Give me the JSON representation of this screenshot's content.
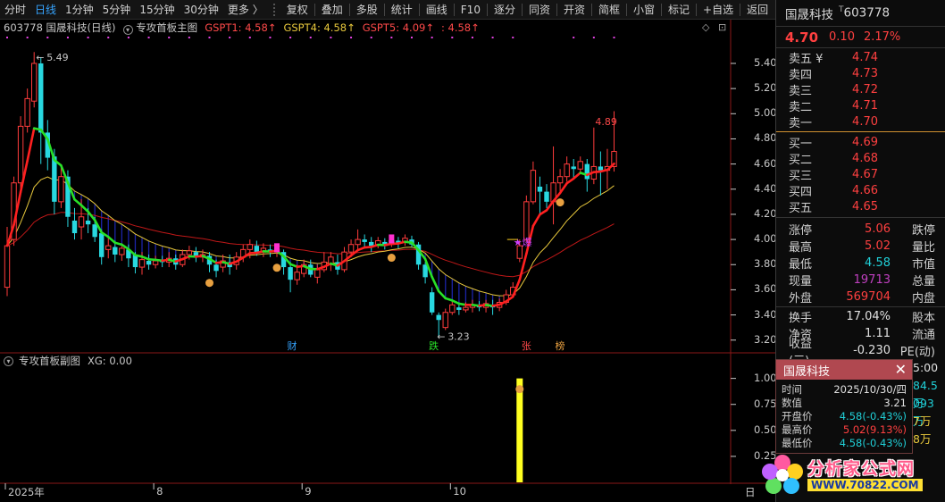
{
  "toolbar": {
    "left_items": [
      {
        "label": "分时",
        "active": false
      },
      {
        "label": "日线",
        "active": true
      },
      {
        "label": "1分钟",
        "active": false
      },
      {
        "label": "5分钟",
        "active": false
      },
      {
        "label": "15分钟",
        "active": false
      },
      {
        "label": "30分钟",
        "active": false
      },
      {
        "label": "更多 〉",
        "active": false
      }
    ],
    "right_items": [
      "复权",
      "叠加",
      "多股",
      "统计",
      "画线",
      "F10",
      "逐分",
      "同资",
      "开资",
      "简框",
      "小窗",
      "标记",
      "+自选",
      "返回"
    ]
  },
  "main_header": {
    "title": "603778 国晟科技(日线)",
    "indicator": "专攻首板主图",
    "gspt1": "GSPT1: 4.58↑",
    "gspt4": "GSPT4: 4.58↑",
    "gspt5": "GSPT5: 4.09↑",
    "extra": ": 4.58↑"
  },
  "sub_header": {
    "indicator": "专攻首板副图",
    "xg": "XG: 0.00"
  },
  "chart_labels": {
    "high_note": "5.49",
    "peak_note": "4.89",
    "low_note": "3.23",
    "signal_star": "★爆",
    "tag_cai": "财",
    "tag_die": "跌",
    "tag_zhang": "张",
    "tag_bang": "榜"
  },
  "chart_data": [
    {
      "type": "candlestick",
      "name": "main",
      "y_ticks": [
        3.2,
        3.4,
        3.6,
        3.8,
        4.0,
        4.2,
        4.4,
        4.6,
        4.8,
        5.0,
        5.2,
        5.4
      ],
      "ylim": [
        3.12,
        5.62
      ],
      "x_ticks": [
        "2025年",
        "8",
        "9",
        "10"
      ],
      "candles": [
        [
          3.62,
          3.95,
          3.55,
          4.1
        ],
        [
          4.0,
          4.45,
          3.95,
          4.5
        ],
        [
          4.45,
          4.9,
          4.4,
          4.98
        ],
        [
          4.9,
          5.12,
          4.85,
          5.2
        ],
        [
          5.1,
          5.4,
          5.05,
          5.49
        ],
        [
          5.4,
          4.85,
          4.6,
          5.45
        ],
        [
          4.85,
          4.65,
          4.55,
          4.95
        ],
        [
          4.66,
          4.3,
          4.2,
          4.72
        ],
        [
          4.3,
          4.5,
          4.25,
          4.6
        ],
        [
          4.5,
          4.18,
          4.1,
          4.55
        ],
        [
          4.15,
          4.05,
          4.0,
          4.25
        ],
        [
          4.1,
          4.18,
          4.0,
          4.32
        ],
        [
          4.15,
          4.12,
          4.05,
          4.25
        ],
        [
          4.12,
          4.02,
          3.98,
          4.18
        ],
        [
          4.05,
          3.86,
          3.8,
          4.08
        ],
        [
          3.92,
          3.95,
          3.85,
          4.02
        ],
        [
          3.94,
          3.88,
          3.82,
          3.99
        ],
        [
          3.88,
          3.93,
          3.83,
          3.97
        ],
        [
          3.92,
          3.85,
          3.78,
          3.96
        ],
        [
          3.88,
          3.78,
          3.73,
          3.9
        ],
        [
          3.78,
          3.84,
          3.72,
          3.9
        ],
        [
          3.83,
          3.8,
          3.76,
          3.88
        ],
        [
          3.8,
          3.83,
          3.77,
          3.87
        ],
        [
          3.83,
          3.82,
          3.78,
          3.87
        ],
        [
          3.82,
          3.85,
          3.78,
          3.9
        ],
        [
          3.85,
          3.8,
          3.76,
          3.88
        ],
        [
          3.8,
          3.88,
          3.78,
          3.92
        ],
        [
          3.88,
          3.91,
          3.84,
          3.95
        ],
        [
          3.9,
          3.86,
          3.82,
          3.94
        ],
        [
          3.86,
          3.88,
          3.82,
          3.92
        ],
        [
          3.87,
          3.8,
          3.74,
          3.9
        ],
        [
          3.8,
          3.75,
          3.7,
          3.84
        ],
        [
          3.78,
          3.83,
          3.74,
          3.88
        ],
        [
          3.82,
          3.78,
          3.72,
          3.88
        ],
        [
          3.8,
          3.86,
          3.76,
          3.9
        ],
        [
          3.86,
          3.92,
          3.82,
          3.96
        ],
        [
          3.92,
          3.96,
          3.85,
          4.0
        ],
        [
          3.95,
          3.9,
          3.87,
          3.99
        ],
        [
          3.9,
          3.93,
          3.86,
          3.97
        ],
        [
          3.92,
          3.9,
          3.86,
          3.96
        ],
        [
          3.9,
          3.92,
          3.86,
          3.95
        ],
        [
          3.9,
          3.78,
          3.72,
          3.92
        ],
        [
          3.78,
          3.68,
          3.58,
          3.82
        ],
        [
          3.68,
          3.74,
          3.64,
          3.8
        ],
        [
          3.73,
          3.8,
          3.7,
          3.84
        ],
        [
          3.8,
          3.72,
          3.7,
          3.84
        ],
        [
          3.7,
          3.76,
          3.65,
          3.8
        ],
        [
          3.76,
          3.82,
          3.74,
          3.9
        ],
        [
          3.8,
          3.86,
          3.75,
          3.9
        ],
        [
          3.82,
          3.76,
          3.72,
          3.88
        ],
        [
          3.76,
          3.9,
          3.74,
          3.94
        ],
        [
          3.9,
          3.96,
          3.86,
          4.0
        ],
        [
          3.96,
          4.0,
          3.92,
          4.08
        ],
        [
          4.0,
          3.98,
          3.94,
          4.04
        ],
        [
          3.98,
          3.95,
          3.9,
          4.02
        ],
        [
          3.96,
          3.99,
          3.93,
          4.02
        ],
        [
          3.98,
          3.95,
          3.92,
          4.01
        ],
        [
          3.96,
          3.99,
          3.94,
          4.02
        ],
        [
          3.99,
          3.97,
          3.93,
          4.02
        ],
        [
          3.98,
          4.01,
          3.95,
          4.04
        ],
        [
          4.0,
          3.96,
          3.94,
          4.03
        ],
        [
          3.96,
          3.8,
          3.76,
          3.98
        ],
        [
          3.8,
          3.7,
          3.65,
          3.82
        ],
        [
          3.58,
          3.42,
          3.4,
          3.62
        ],
        [
          3.4,
          3.36,
          3.23,
          3.42
        ],
        [
          3.3,
          3.42,
          3.28,
          3.45
        ],
        [
          3.42,
          3.48,
          3.4,
          3.52
        ],
        [
          3.46,
          3.44,
          3.4,
          3.5
        ],
        [
          3.44,
          3.46,
          3.42,
          3.5
        ],
        [
          3.46,
          3.48,
          3.42,
          3.52
        ],
        [
          3.48,
          3.46,
          3.43,
          3.51
        ],
        [
          3.46,
          3.49,
          3.42,
          3.52
        ],
        [
          3.48,
          3.46,
          3.4,
          3.52
        ],
        [
          3.46,
          3.5,
          3.43,
          3.53
        ],
        [
          3.5,
          3.56,
          3.48,
          3.6
        ],
        [
          3.56,
          3.62,
          3.54,
          3.66
        ],
        [
          3.85,
          3.95,
          3.82,
          4.0
        ],
        [
          4.0,
          4.3,
          3.98,
          4.35
        ],
        [
          4.3,
          4.55,
          4.28,
          4.62
        ],
        [
          4.42,
          4.38,
          4.2,
          4.5
        ],
        [
          4.38,
          4.3,
          4.25,
          4.44
        ],
        [
          4.3,
          4.45,
          4.12,
          4.74
        ],
        [
          4.45,
          4.5,
          4.38,
          4.56
        ],
        [
          4.5,
          4.6,
          4.46,
          4.66
        ],
        [
          4.58,
          4.56,
          4.48,
          4.64
        ],
        [
          4.56,
          4.62,
          4.52,
          4.66
        ],
        [
          4.6,
          4.48,
          4.38,
          4.64
        ],
        [
          4.48,
          4.58,
          4.44,
          4.89
        ],
        [
          4.58,
          4.55,
          4.35,
          4.7
        ],
        [
          4.55,
          4.58,
          4.4,
          4.72
        ],
        [
          4.58,
          4.7,
          4.54,
          5.02
        ]
      ]
    },
    {
      "type": "bar",
      "name": "sub",
      "y_ticks": [
        0.25,
        0.5,
        0.75,
        1.0
      ],
      "ylim": [
        0,
        1.1
      ],
      "signal_value": 1.0,
      "signal_index": 76
    }
  ],
  "y_labels": [
    "5.40",
    "5.20",
    "5.00",
    "4.80",
    "4.60",
    "4.40",
    "4.20",
    "4.00",
    "3.80",
    "3.60",
    "3.40",
    "3.20"
  ],
  "sub_y_labels": [
    "1.00",
    "0.75",
    "0.50",
    "0.25"
  ],
  "x_labels": [
    {
      "text": "2025年",
      "index": 0
    },
    {
      "text": "8",
      "index": 22
    },
    {
      "text": "9",
      "index": 44
    },
    {
      "text": "10",
      "index": 66
    }
  ],
  "x_axis_date_fragment": "日",
  "quote": {
    "name": "国晟科技",
    "code_mark": "T",
    "code": "603778",
    "price": "4.70",
    "change": "0.10",
    "pct": "2.17%",
    "sell": [
      {
        "label": "卖五 ¥",
        "value": "4.74"
      },
      {
        "label": "卖四",
        "value": "4.73"
      },
      {
        "label": "卖三",
        "value": "4.72"
      },
      {
        "label": "卖二",
        "value": "4.71"
      },
      {
        "label": "卖一",
        "value": "4.70"
      }
    ],
    "buy": [
      {
        "label": "买一",
        "value": "4.69"
      },
      {
        "label": "买二",
        "value": "4.68"
      },
      {
        "label": "买三",
        "value": "4.67"
      },
      {
        "label": "买四",
        "value": "4.66"
      },
      {
        "label": "买五",
        "value": "4.65"
      }
    ],
    "stats": [
      {
        "label": "涨停",
        "value": "5.06",
        "color": "#ff4040",
        "label2": "跌停"
      },
      {
        "label": "最高",
        "value": "5.02",
        "color": "#ff4040",
        "label2": "量比"
      },
      {
        "label": "最低",
        "value": "4.58",
        "color": "#20d0d8",
        "label2": "市值"
      },
      {
        "label": "现量",
        "value": "19713",
        "color": "#c040c0",
        "label2": "总量"
      },
      {
        "label": "外盘",
        "value": "569704",
        "color": "#ff4040",
        "label2": "内盘"
      },
      {
        "label": "换手",
        "value": "17.04%",
        "color": "#e0e0e0",
        "label2": "股本"
      },
      {
        "label": "净资",
        "value": "1.11",
        "color": "#e0e0e0",
        "label2": "流通"
      },
      {
        "label": "收益(三)",
        "value": "-0.230",
        "color": "#e0e0e0",
        "label2": "PE(动)"
      }
    ]
  },
  "popup": {
    "title": "国晟科技",
    "close": "✕",
    "rows": [
      {
        "label": "时间",
        "value": "2025/10/30/四",
        "color": "#e0e0e0"
      },
      {
        "label": "数值",
        "value": "3.21",
        "color": "#e0e0e0"
      },
      {
        "label": "开盘价",
        "value": "4.58(-0.43%)",
        "color": "#20d0d8"
      },
      {
        "label": "最高价",
        "value": "5.02(9.13%)",
        "color": "#ff4040"
      },
      {
        "label": "最低价",
        "value": "4.58(-0.43%)",
        "color": "#20d0d8"
      }
    ],
    "peek": [
      {
        "text": "5:00",
        "color": "#e0e0e0"
      },
      {
        "text": "84.5万",
        "color": "#20d0d8"
      },
      {
        "text": "093万",
        "color": "#20d0d8"
      },
      {
        "text": "7万",
        "color": "#e8c83c"
      },
      {
        "text": "8万",
        "color": "#e8c83c"
      }
    ]
  },
  "watermark": {
    "text": "分析家公式网",
    "url": "WWW.70822.COM"
  },
  "colors": {
    "up": "#ff3c3c",
    "down": "#28d8e0",
    "ma_up": "#ff2020",
    "ma_down": "#28e028",
    "yellow_line": "#e8c83c",
    "slow_line": "#c01818",
    "fill": "#1c24a8",
    "grid": "#2a2a2a"
  }
}
